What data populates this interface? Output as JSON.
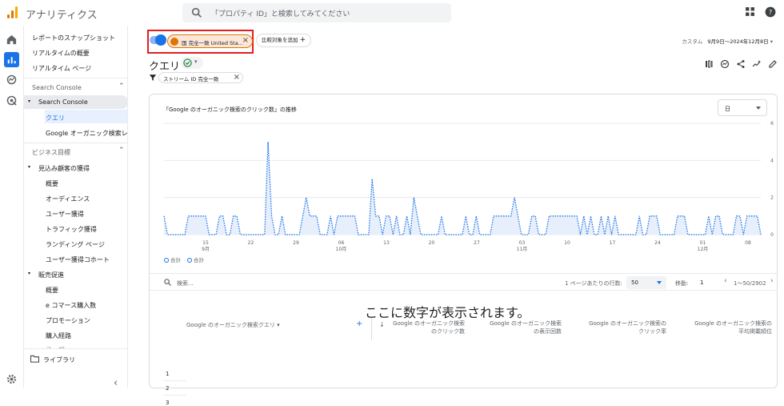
{
  "app": {
    "title": "アナリティクス",
    "search_placeholder": "「プロパティ ID」と検索してみてください"
  },
  "icons": {
    "search": "search-icon",
    "apps": "apps-grid-icon",
    "help": "help-icon",
    "home": "home-icon",
    "reports": "reports-icon",
    "explore": "explore-icon",
    "advertising": "advertising-icon",
    "settings": "gear-icon",
    "folder": "folder-icon"
  },
  "nav": {
    "top_items": [
      "レポートのスナップショット",
      "リアルタイムの概要",
      "リアルタイム ページ"
    ],
    "section1": "Search Console",
    "section1_group": "Search Console",
    "section1_items": [
      "クエリ",
      "Google オーガニック検索レ..."
    ],
    "section2": "ビジネス目標",
    "group_acq": "見込み顧客の獲得",
    "acq_items": [
      "概要",
      "オーディエンス",
      "ユーザー獲得",
      "トラフィック獲得",
      "ランディング ページ",
      "ユーザー獲得コホート"
    ],
    "group_sales": "販売促進",
    "sales_items": [
      "概要",
      "e コマース購入数",
      "プロモーション",
      "購入経路"
    ],
    "sales_cut": "ユーザー",
    "library": "ライブラリ",
    "collapse": "‹"
  },
  "comparison": {
    "chip_label": "国 完全一致 United Sta...",
    "add_label": "比較対象を追加"
  },
  "date": {
    "label": "カスタム",
    "range": "9月9日〜2024年12月8日"
  },
  "page": {
    "title": "クエリ",
    "filter_chip": "ストリーム ID 完全一致"
  },
  "chart": {
    "title": "「Google のオーガニック検索のクリック数」の推移",
    "granularity": "日",
    "legend": [
      "合計",
      "合計"
    ]
  },
  "table": {
    "search_placeholder": "検索...",
    "rows_label": "1 ページあたりの行数:",
    "rows_value": "50",
    "move_label": "移動:",
    "move_value": "1",
    "pagination": "1〜50/2902",
    "dim_header": "Google のオーガニック検索クエリ",
    "metric_headers": [
      [
        "Google のオーガニック検索",
        "のクリック数"
      ],
      [
        "Google のオーガニック検索",
        "の表示回数"
      ],
      [
        "Google のオーガニック検索の",
        "クリック率"
      ],
      [
        "Google のオーガニック検索の",
        "平均掲載順位"
      ]
    ],
    "row_numbers": [
      "1",
      "2",
      "3"
    ],
    "notice": "ここに数字が表示されます。"
  },
  "chart_data": {
    "type": "area",
    "title": "「Google のオーガニック検索のクリック数」の推移",
    "x_tick_labels": [
      [
        "15",
        "9月"
      ],
      [
        "22",
        ""
      ],
      [
        "29",
        ""
      ],
      [
        "06",
        "10月"
      ],
      [
        "13",
        ""
      ],
      [
        "20",
        ""
      ],
      [
        "27",
        ""
      ],
      [
        "03",
        "11月"
      ],
      [
        "10",
        ""
      ],
      [
        "17",
        ""
      ],
      [
        "24",
        ""
      ],
      [
        "01",
        "12月"
      ],
      [
        "08",
        ""
      ]
    ],
    "y_tick_labels": [
      "0",
      "2",
      "4",
      "6"
    ],
    "ylim": [
      0,
      6
    ],
    "series": [
      {
        "values": [
          1,
          0,
          0,
          0,
          0,
          0,
          0,
          1,
          1,
          1,
          1,
          1,
          1,
          0,
          0,
          0,
          1,
          1,
          0,
          0,
          1,
          1,
          0,
          0,
          0,
          0,
          0,
          0,
          0,
          0,
          5,
          1,
          0,
          0,
          1,
          0,
          0,
          0,
          0,
          0,
          1,
          2,
          1,
          1,
          1,
          0,
          0,
          0,
          1,
          0,
          1,
          1,
          1,
          1,
          1,
          1,
          0,
          0,
          0,
          0,
          3,
          1,
          1,
          0,
          1,
          1,
          0,
          1,
          0,
          0,
          1,
          0,
          2,
          1,
          0,
          0,
          0,
          0,
          0,
          0,
          1,
          0,
          0,
          0,
          0,
          0,
          0,
          1,
          0,
          0,
          1,
          0,
          0,
          0,
          0,
          1,
          1,
          1,
          1,
          1,
          1,
          2,
          1,
          0,
          0,
          0,
          1,
          1,
          0,
          0,
          0,
          1,
          1,
          1,
          1,
          1,
          1,
          1,
          1,
          1,
          0,
          1,
          0,
          1,
          0,
          0,
          1,
          0,
          1,
          0,
          1,
          0,
          0,
          0,
          0,
          0,
          0,
          1,
          0,
          0,
          1,
          1,
          1,
          0,
          0,
          0,
          0,
          0,
          1,
          1,
          1,
          0,
          0,
          0,
          0,
          0,
          0,
          1,
          0,
          1,
          1,
          0,
          0,
          0,
          0,
          1,
          1,
          0,
          1,
          1,
          1,
          1,
          0
        ],
        "style": "dotted"
      }
    ]
  },
  "colors": {
    "accent": "#1a73e8",
    "highlight_box": "#e02020",
    "chip_orange": "#e37400",
    "series_line": "#1a73e8",
    "series_fill": "#e8effc"
  }
}
